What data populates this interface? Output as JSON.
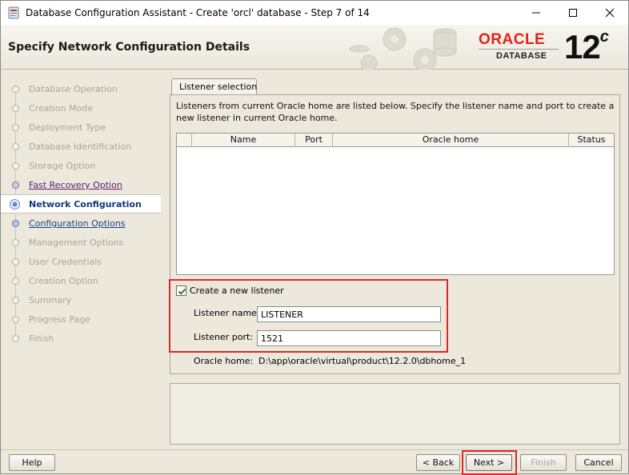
{
  "window": {
    "title": "Database Configuration Assistant - Create 'orcl' database - Step 7 of 14"
  },
  "header": {
    "title": "Specify Network Configuration Details",
    "logo_brand": "ORACLE",
    "logo_product": "DATABASE",
    "logo_version": "12",
    "logo_version_suffix": "c"
  },
  "steps": [
    {
      "label": "Database Operation",
      "state": "disabled"
    },
    {
      "label": "Creation Mode",
      "state": "disabled"
    },
    {
      "label": "Deployment Type",
      "state": "disabled"
    },
    {
      "label": "Database Identification",
      "state": "disabled"
    },
    {
      "label": "Storage Option",
      "state": "disabled"
    },
    {
      "label": "Fast Recovery Option",
      "state": "done"
    },
    {
      "label": "Network Configuration",
      "state": "current"
    },
    {
      "label": "Configuration Options",
      "state": "next"
    },
    {
      "label": "Management Options",
      "state": "disabled"
    },
    {
      "label": "User Credentials",
      "state": "disabled"
    },
    {
      "label": "Creation Option",
      "state": "disabled"
    },
    {
      "label": "Summary",
      "state": "disabled"
    },
    {
      "label": "Progress Page",
      "state": "disabled"
    },
    {
      "label": "Finish",
      "state": "disabled"
    }
  ],
  "main": {
    "tab_label": "Listener selection",
    "description": "Listeners from current Oracle home are listed below. Specify the listener name and port to create a new listener in current Oracle home.",
    "table": {
      "columns": [
        "",
        "Name",
        "Port",
        "Oracle home",
        "Status"
      ],
      "rows": []
    },
    "create_listener": {
      "checked": true,
      "label": "Create a new listener"
    },
    "listener_name": {
      "label": "Listener name:",
      "value": "LISTENER"
    },
    "listener_port": {
      "label": "Listener port:",
      "value": "1521"
    },
    "oracle_home": {
      "label": "Oracle home:",
      "value": "D:\\app\\oracle\\virtual\\product\\12.2.0\\dbhome_1"
    }
  },
  "buttons": {
    "help": "Help",
    "back": "< Back",
    "next": "Next >",
    "finish": "Finish",
    "cancel": "Cancel"
  },
  "colors": {
    "oracle_red": "#e2231a",
    "highlight": "#e0252b",
    "current_step": "#123a7a"
  }
}
